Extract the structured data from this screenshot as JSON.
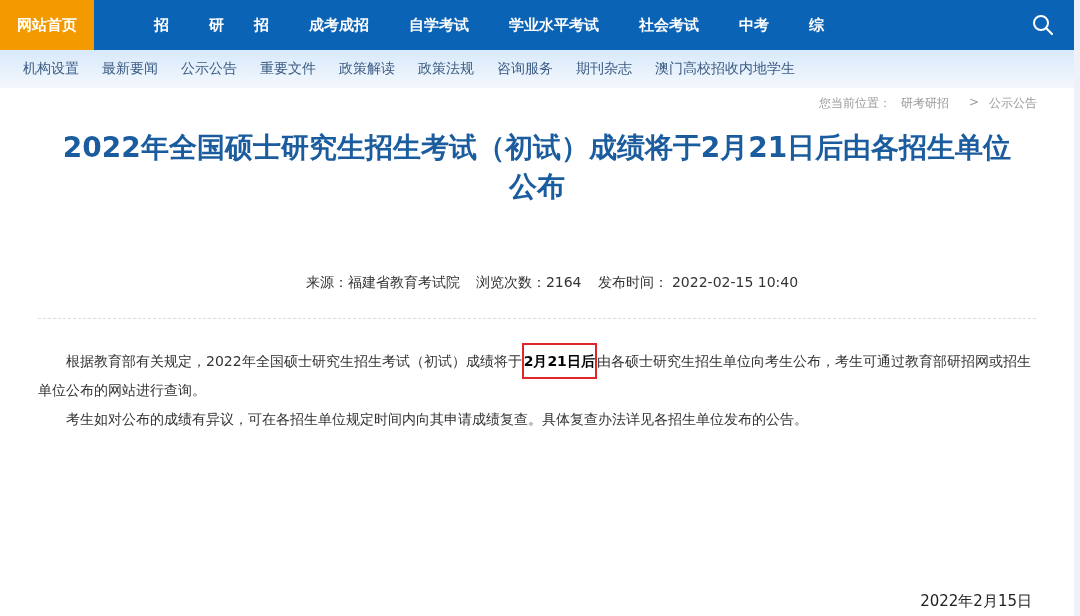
{
  "top_nav": [
    {
      "label": "网站首页",
      "selected": true
    },
    {
      "label": "招",
      "selected": false
    },
    {
      "label": "研　　招",
      "selected": false
    },
    {
      "label": "成考成招",
      "selected": false
    },
    {
      "label": "自学考试",
      "selected": false
    },
    {
      "label": "学业水平考试",
      "selected": false
    },
    {
      "label": "社会考试",
      "selected": false
    },
    {
      "label": "中考",
      "selected": false
    },
    {
      "label": "综",
      "selected": false
    }
  ],
  "sub_nav": [
    "机构设置",
    "最新要闻",
    "公示公告",
    "重要文件",
    "政策解读",
    "政策法规",
    "咨询服务",
    "期刊杂志",
    "澳门高校招收内地学生"
  ],
  "breadcrumb": {
    "prefix": "您当前位置：",
    "items": [
      "研考研招",
      "公示公告"
    ],
    "separator": ">"
  },
  "article": {
    "title": "2022年全国硕士研究生招生考试（初试）成绩将于2月21日后由各招生单位公布",
    "meta": [
      "来源：福建省教育考试院",
      "浏览次数：2164",
      "发布时间： 2022-02-15 10:40"
    ],
    "paragraphs": [
      "根据教育部有关规定，2022年全国硕士研究生招生考试（初试）成绩将于**2月21日后**由各硕士研究生招生单位向考生公布，考生可通过教育部研招网或招生单位公布的网站进行查询。",
      "考生如对公布的成绩有异议，可在各招生单位规定时间内向其申请成绩复查。具体复查办法详见各招生单位发布的公告。"
    ]
  },
  "capture_date": "2022年2月15日"
}
